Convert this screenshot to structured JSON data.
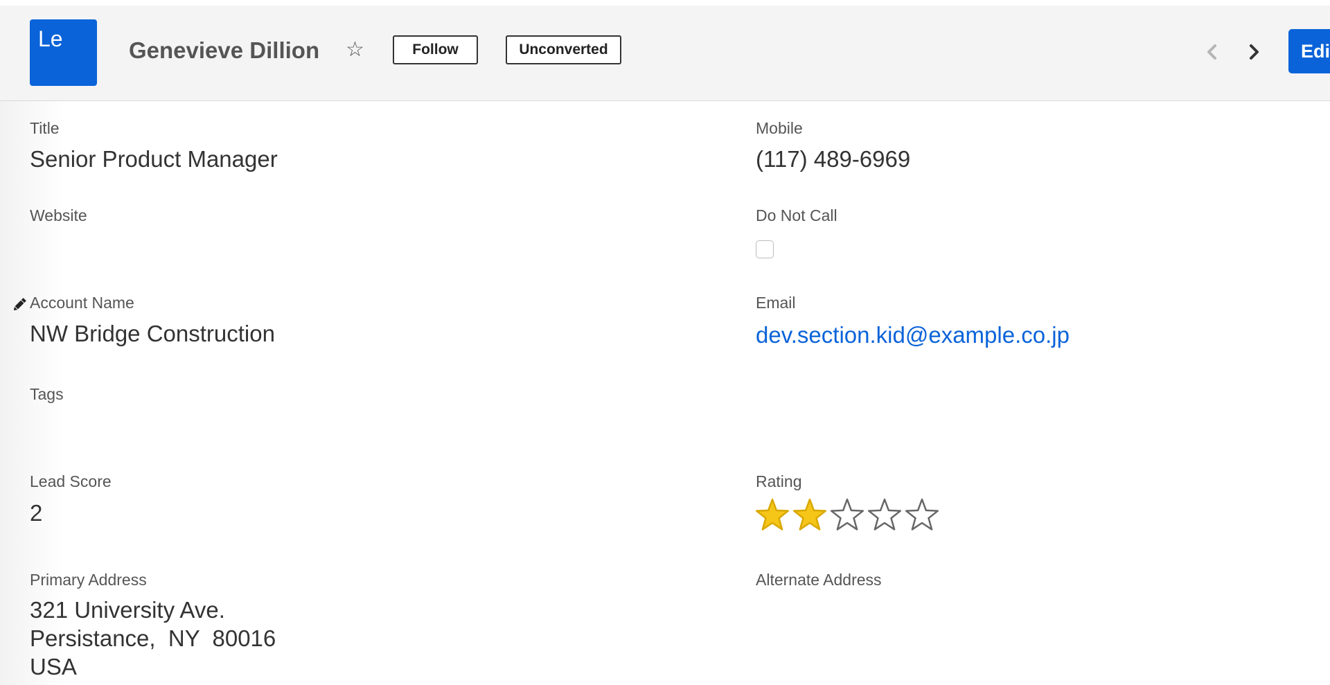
{
  "header": {
    "module_abbr": "Le",
    "record_name": "Genevieve Dillion",
    "follow_label": "Follow",
    "status_label": "Unconverted",
    "edit_label": "Edit"
  },
  "icons": {
    "favorite": "star-outline-icon",
    "prev": "chevron-left-icon",
    "next": "chevron-right-icon",
    "edit_field": "pencil-icon"
  },
  "colors": {
    "brand": "#0a63d9",
    "star_filled": "#f5c518",
    "star_empty_stroke": "#666666",
    "label": "#555555",
    "value": "#333333"
  },
  "fields": {
    "title": {
      "label": "Title",
      "value": "Senior Product Manager"
    },
    "mobile": {
      "label": "Mobile",
      "value": "(117) 489-6969"
    },
    "website": {
      "label": "Website",
      "value": ""
    },
    "do_not_call": {
      "label": "Do Not Call",
      "checked": false
    },
    "account_name": {
      "label": "Account Name",
      "value": "NW Bridge Construction"
    },
    "email": {
      "label": "Email",
      "value": "dev.section.kid@example.co.jp"
    },
    "tags": {
      "label": "Tags",
      "value": ""
    },
    "lead_score": {
      "label": "Lead Score",
      "value": "2"
    },
    "rating": {
      "label": "Rating",
      "value": 2,
      "max": 5
    },
    "primary_address": {
      "label": "Primary Address",
      "line1": "321 University Ave.",
      "line2": "Persistance,  NY  80016",
      "line3": "USA"
    },
    "alternate_address": {
      "label": "Alternate Address",
      "value": ""
    }
  }
}
